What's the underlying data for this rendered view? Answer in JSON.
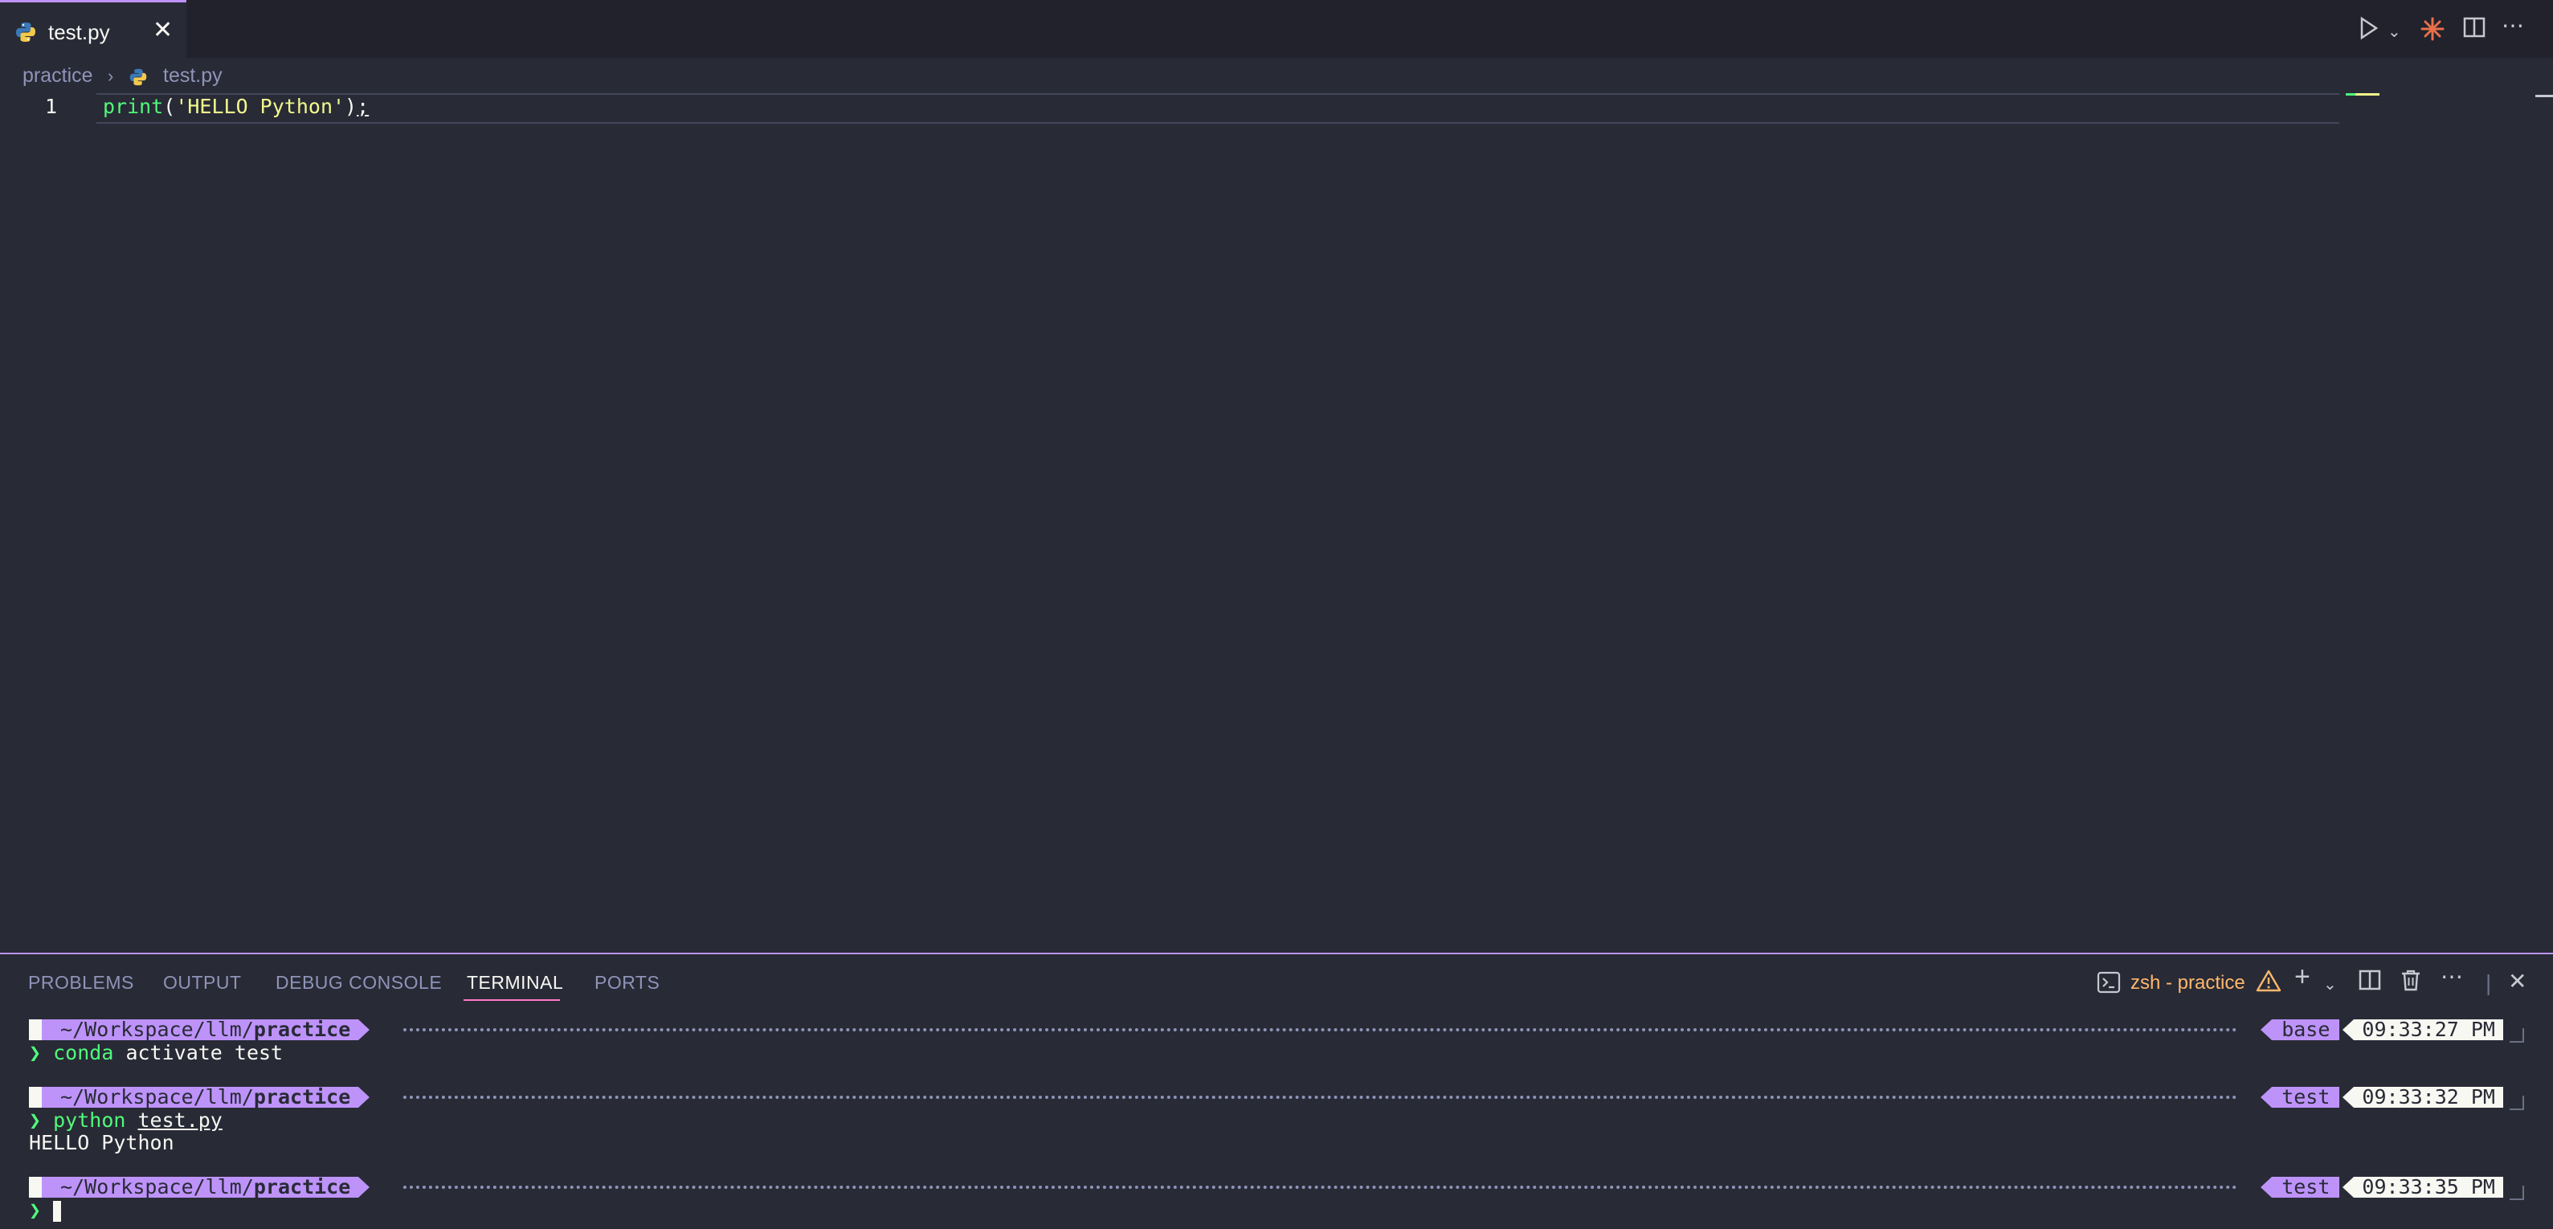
{
  "tab": {
    "title": "test.py"
  },
  "breadcrumb": {
    "folder": "practice",
    "file": "test.py"
  },
  "editor": {
    "line_number": "1",
    "code_fn": "print",
    "code_open": "(",
    "code_str": "'HELLO Python'",
    "code_close": ")",
    "code_semi": ";"
  },
  "panel": {
    "tabs": [
      "PROBLEMS",
      "OUTPUT",
      "DEBUG CONSOLE",
      "TERMINAL",
      "PORTS"
    ],
    "active_tab": "TERMINAL",
    "shell": "zsh - practice"
  },
  "terminal": {
    "path_prefix": " ~/Workspace/llm/",
    "path_dir": "practice",
    "glyph": "",
    "prompt_char": "❯",
    "blocks": [
      {
        "env": "base ",
        "time": "09:33:27 PM ",
        "cmd_head": "conda",
        "cmd_tail": " activate test",
        "cmd_arg": "",
        "output": ""
      },
      {
        "env": "test ",
        "time": "09:33:32 PM ",
        "cmd_head": "python",
        "cmd_tail": " ",
        "cmd_arg": "test.py",
        "output": "HELLO Python"
      },
      {
        "env": "test ",
        "time": "09:33:35 PM ",
        "cmd_head": "",
        "cmd_tail": "",
        "cmd_arg": "",
        "output": ""
      }
    ]
  },
  "colors": {
    "accent": "#bd93f9",
    "bg": "#282a36",
    "green": "#50fa7b",
    "yellow": "#f1fa8c",
    "orange": "#ffb86c"
  }
}
